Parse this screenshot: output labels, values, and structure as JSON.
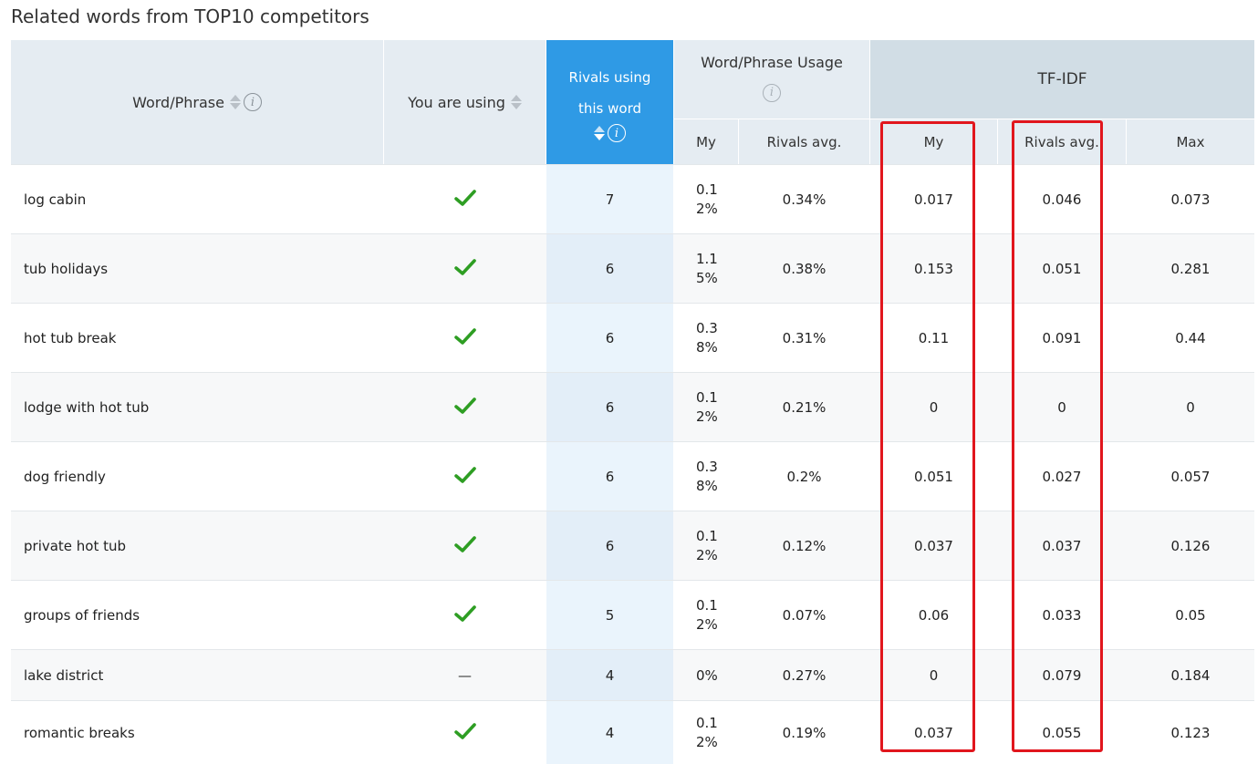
{
  "title": "Related words from TOP10 competitors",
  "header": {
    "word_phrase": "Word/Phrase",
    "you_are_using": "You are using",
    "rivals_using_line1": "Rivals using",
    "rivals_using_line2": "this word",
    "usage_group": "Word/Phrase Usage",
    "tfidf_group": "TF-IDF",
    "usage_my": "My",
    "usage_rivals_avg": "Rivals avg.",
    "tfidf_my": "My",
    "tfidf_rivals_avg": "Rivals avg.",
    "tfidf_max": "Max",
    "info_glyph": "i"
  },
  "rows": [
    {
      "word": "log cabin",
      "using": true,
      "rivals": "7",
      "usage_my": "0.1\n2%",
      "usage_rivals": "0.34%",
      "tfidf_my": "0.017",
      "tfidf_rivals": "0.046",
      "tfidf_max": "0.073"
    },
    {
      "word": "tub holidays",
      "using": true,
      "rivals": "6",
      "usage_my": "1.1\n5%",
      "usage_rivals": "0.38%",
      "tfidf_my": "0.153",
      "tfidf_rivals": "0.051",
      "tfidf_max": "0.281"
    },
    {
      "word": "hot tub break",
      "using": true,
      "rivals": "6",
      "usage_my": "0.3\n8%",
      "usage_rivals": "0.31%",
      "tfidf_my": "0.11",
      "tfidf_rivals": "0.091",
      "tfidf_max": "0.44"
    },
    {
      "word": "lodge with hot tub",
      "using": true,
      "rivals": "6",
      "usage_my": "0.1\n2%",
      "usage_rivals": "0.21%",
      "tfidf_my": "0",
      "tfidf_rivals": "0",
      "tfidf_max": "0"
    },
    {
      "word": "dog friendly",
      "using": true,
      "rivals": "6",
      "usage_my": "0.3\n8%",
      "usage_rivals": "0.2%",
      "tfidf_my": "0.051",
      "tfidf_rivals": "0.027",
      "tfidf_max": "0.057"
    },
    {
      "word": "private hot tub",
      "using": true,
      "rivals": "6",
      "usage_my": "0.1\n2%",
      "usage_rivals": "0.12%",
      "tfidf_my": "0.037",
      "tfidf_rivals": "0.037",
      "tfidf_max": "0.126"
    },
    {
      "word": "groups of friends",
      "using": true,
      "rivals": "5",
      "usage_my": "0.1\n2%",
      "usage_rivals": "0.07%",
      "tfidf_my": "0.06",
      "tfidf_rivals": "0.033",
      "tfidf_max": "0.05"
    },
    {
      "word": "lake district",
      "using": false,
      "using_text": "—",
      "rivals": "4",
      "usage_my": "0%",
      "usage_rivals": "0.27%",
      "tfidf_my": "0",
      "tfidf_rivals": "0.079",
      "tfidf_max": "0.184"
    },
    {
      "word": "romantic breaks",
      "using": true,
      "rivals": "4",
      "usage_my": "0.1\n2%",
      "usage_rivals": "0.19%",
      "tfidf_my": "0.037",
      "tfidf_rivals": "0.055",
      "tfidf_max": "0.123"
    }
  ],
  "colors": {
    "rivals_header": "#2f9ae5",
    "check": "#2e9e23",
    "highlight": "#e1161d"
  },
  "icons": {
    "check": "check-icon",
    "sort": "sort-arrows-icon",
    "info": "info-icon"
  }
}
